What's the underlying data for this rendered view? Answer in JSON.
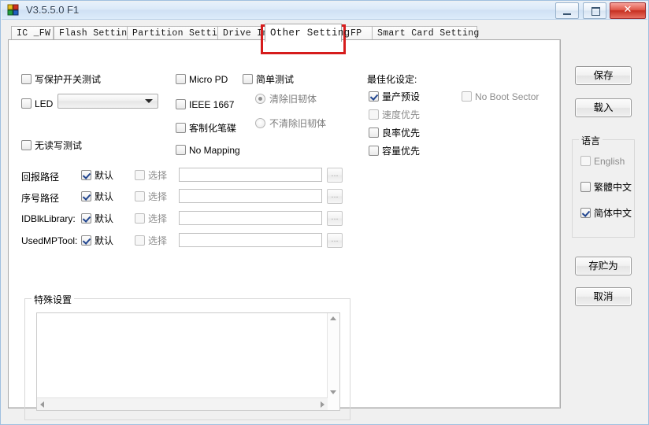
{
  "window": {
    "title": "V3.5.5.0 F1",
    "icon": "app-icon",
    "buttons": {
      "minimize": "minimize-button",
      "maximize": "maximize-button",
      "close": "✕"
    }
  },
  "tabs": [
    {
      "label": "IC _FW",
      "active": false
    },
    {
      "label": "Flash Setting",
      "active": false
    },
    {
      "label": "Partition Setting",
      "active": false
    },
    {
      "label": "Drive Info",
      "active": false
    },
    {
      "label": "Other Setting",
      "active": true
    },
    {
      "label": "FP",
      "active": false
    },
    {
      "label": "Smart Card Setting",
      "active": false
    }
  ],
  "annotation": {
    "target": "Other Setting",
    "color": "#d61c1c"
  },
  "other_setting": {
    "col1": [
      {
        "label": "写保护开关测试",
        "checked": false,
        "disabled": false
      },
      {
        "label": "LED",
        "checked": false,
        "disabled": false
      },
      {
        "label": "无读写测试",
        "checked": false,
        "disabled": false
      }
    ],
    "led_combo": {
      "value": "",
      "options": []
    },
    "col2": [
      {
        "label": "Micro PD",
        "checked": false,
        "disabled": false
      },
      {
        "label": "IEEE 1667",
        "checked": false,
        "disabled": false
      },
      {
        "label": "客制化笔碟",
        "checked": false,
        "disabled": false
      },
      {
        "label": "No Mapping",
        "checked": false,
        "disabled": false
      }
    ],
    "simple_test": {
      "label": "简单测试",
      "checked": false
    },
    "simple_test_options": [
      {
        "label": "清除旧韧体",
        "selected": true
      },
      {
        "label": "不清除旧韧体",
        "selected": false
      }
    ],
    "optimize": {
      "title": "最佳化设定:",
      "items": [
        {
          "label": "量产预设",
          "checked": true,
          "disabled": false
        },
        {
          "label": "速度优先",
          "checked": false,
          "disabled": true
        },
        {
          "label": "良率优先",
          "checked": false,
          "disabled": false
        },
        {
          "label": "容量优先",
          "checked": false,
          "disabled": false
        }
      ],
      "no_boot_sector": {
        "label": "No Boot Sector",
        "checked": false,
        "disabled": true
      }
    },
    "paths": [
      {
        "label": "回报路径",
        "default_label": "默认",
        "default_checked": true,
        "select_label": "选择",
        "select_checked": false,
        "value": "",
        "browse": "..."
      },
      {
        "label": "序号路径",
        "default_label": "默认",
        "default_checked": true,
        "select_label": "选择",
        "select_checked": false,
        "value": "",
        "browse": "..."
      },
      {
        "label": "IDBlkLibrary:",
        "default_label": "默认",
        "default_checked": true,
        "select_label": "选择",
        "select_checked": false,
        "value": "",
        "browse": "..."
      },
      {
        "label": "UsedMPTool:",
        "default_label": "默认",
        "default_checked": true,
        "select_label": "选择",
        "select_checked": false,
        "value": "",
        "browse": "..."
      }
    ],
    "special": {
      "title": "特殊设置",
      "value": ""
    }
  },
  "sidebar": {
    "save_button": "保存",
    "load_button": "载入",
    "language": {
      "title": "语言",
      "items": [
        {
          "label": "English",
          "checked": false
        },
        {
          "label": "繁體中文",
          "checked": false
        },
        {
          "label": "简体中文",
          "checked": true
        }
      ]
    },
    "save_as_button": "存贮为",
    "cancel_button": "取消"
  }
}
